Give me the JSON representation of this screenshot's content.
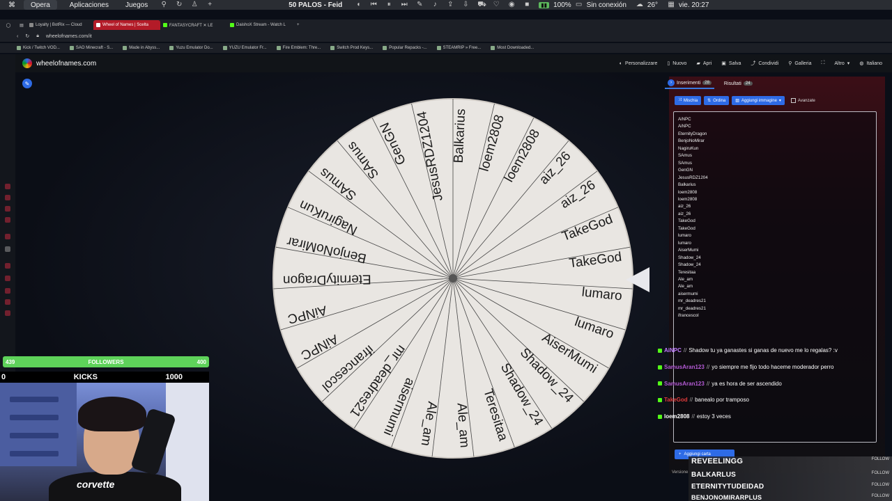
{
  "os_bar": {
    "apps": [
      "Opera",
      "Aplicaciones",
      "Juegos"
    ],
    "now_playing": "50 PALOS - Feid",
    "battery_percent": "100%",
    "network": "Sin conexión",
    "temperature": "26°",
    "clock": "vie. 20:27"
  },
  "browser": {
    "tabs": [
      {
        "title": "Loyalty | BotRix — Cloud"
      },
      {
        "title": "Wheel of Names | Scelta",
        "active": true
      },
      {
        "title": "FANTASYCRAFT ✕ LE"
      },
      {
        "title": "DaishoX Stream - Watch L"
      }
    ],
    "url": "wheelofnames.com/it",
    "bookmarks": [
      "Kick / Twitch VOD...",
      "SAO Minecraft - S...",
      "Made in Abyss...",
      "Yuzu Emulator Do...",
      "YUZU Emulator Fr...",
      "Fire Emblem: Thre...",
      "Switch Prod Keys...",
      "Popular Repacks -...",
      "STEAMRIP » Free...",
      "Most Downloaded..."
    ]
  },
  "site": {
    "name": "wheelofnames.com",
    "menu": [
      "Personalizzare",
      "Nuovo",
      "Apri",
      "Salva",
      "Condividi",
      "Galleria",
      "Altro",
      "Italiano"
    ]
  },
  "wheel": {
    "segments": [
      "aisermumi",
      "mr_deadres21",
      "ifrancescol",
      "AiNPC",
      "AiNPC",
      "EternityDragon",
      "BenjoNoMirar",
      "NagiruKun",
      "SAmus",
      "SAmus",
      "GenGN",
      "JesusRDZ1204",
      "Balkarius",
      "loem2808",
      "loem2808",
      "aiz_26",
      "aiz_26",
      "TakeGod",
      "TakeGod",
      "lumaro",
      "lumaro",
      "AiserMumi",
      "Shadow_24",
      "Shadow_24",
      "Teresitaa",
      "Ale_am",
      "Ale_am"
    ],
    "colors": {
      "segment": "#e9e6e2",
      "text": "#1b1b1b",
      "divider": "#444444",
      "pointer": "#e8e8ec"
    }
  },
  "panel": {
    "tabs": [
      {
        "label": "Inserimenti",
        "count": "28"
      },
      {
        "label": "Risultati",
        "count": "24"
      }
    ],
    "buttons": {
      "shuffle": "Mischia",
      "sort": "Ordina",
      "add_image": "Aggiungi immagine",
      "advanced": "Avanzate"
    },
    "entries": [
      "AiNPC",
      "AiNPC",
      "EternityDragon",
      "BenjoNoMirar",
      "NagiruKun",
      "SAmus",
      "SAmus",
      "GenGN",
      "JesusRDZ1204",
      "Balkarius",
      "loem2808",
      "loem2808",
      "aiz_26",
      "aiz_26",
      "TakeGod",
      "TakeGod",
      "lumaro",
      "lumaro",
      "AiserMumi",
      "Shadow_24",
      "Shadow_24",
      "Teresitaa",
      "Ale_am",
      "Ale_am",
      "aisermumi",
      "mr_deadres21",
      "mr_deadres21",
      "ifrancescol"
    ],
    "add_button": "Aggiungi carta",
    "version": "Versione"
  },
  "chat": [
    {
      "user": "AiNPC",
      "text": "Shadow tu ya ganastes si ganas de nuevo me lo regalas? :v",
      "color": "#c27cff"
    },
    {
      "user": "SamusAran123",
      "text": "yo siempre me fijo todo haceme moderador perro",
      "color": "#b55bd6"
    },
    {
      "user": "SamusAran123",
      "text": "ya es hora de ser ascendido",
      "color": "#b55bd6"
    },
    {
      "user": "TakeGod",
      "text": "banealo por tramposo",
      "color": "#e23b3b"
    },
    {
      "user": "loem2808",
      "text": "estoy 3 veces",
      "color": "#ffffff"
    }
  ],
  "follows": {
    "names": [
      "REVEELINGG",
      "BALKARLUS",
      "ETERNITYTUDEIDAD",
      "BENJONOMIRARPLUS"
    ],
    "tag": "FOLLOW"
  },
  "stream": {
    "followers_label": "FOLLOWERS",
    "followers_current": "439",
    "followers_goal": "400",
    "kicks_start": "0",
    "kicks_label": "KICKS",
    "kicks_goal": "1000",
    "shirt_text": "corvette"
  }
}
